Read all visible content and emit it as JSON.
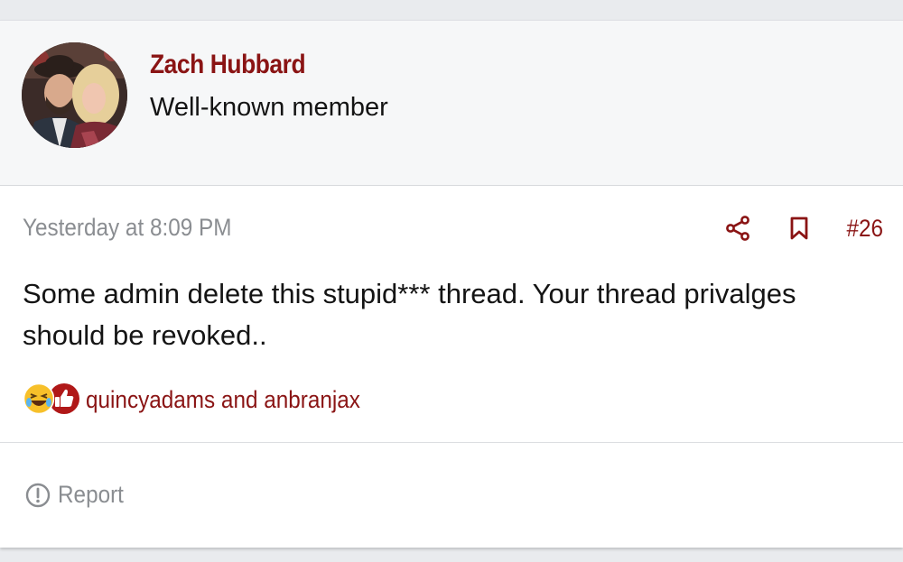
{
  "user": {
    "name": "Zach Hubbard",
    "title": "Well-known member",
    "avatar_icon": "user-photo-avatar"
  },
  "post": {
    "timestamp": "Yesterday at 8:09 PM",
    "number": "#26",
    "message": "Some admin delete this stupid*** thread. Your thread privalges should be revoked..",
    "share_icon": "share-icon",
    "bookmark_icon": "bookmark-icon"
  },
  "reactions": {
    "icons": [
      "laughing-emoji-icon",
      "thumbs-up-icon"
    ],
    "users_text": "quincyadams and anbranjax"
  },
  "footer": {
    "report_label": "Report",
    "report_icon": "exclamation-circle-icon"
  },
  "colors": {
    "accent": "#8a1414",
    "muted": "#8a8d91",
    "text": "#141414",
    "user_block_bg": "#f6f7f8"
  }
}
